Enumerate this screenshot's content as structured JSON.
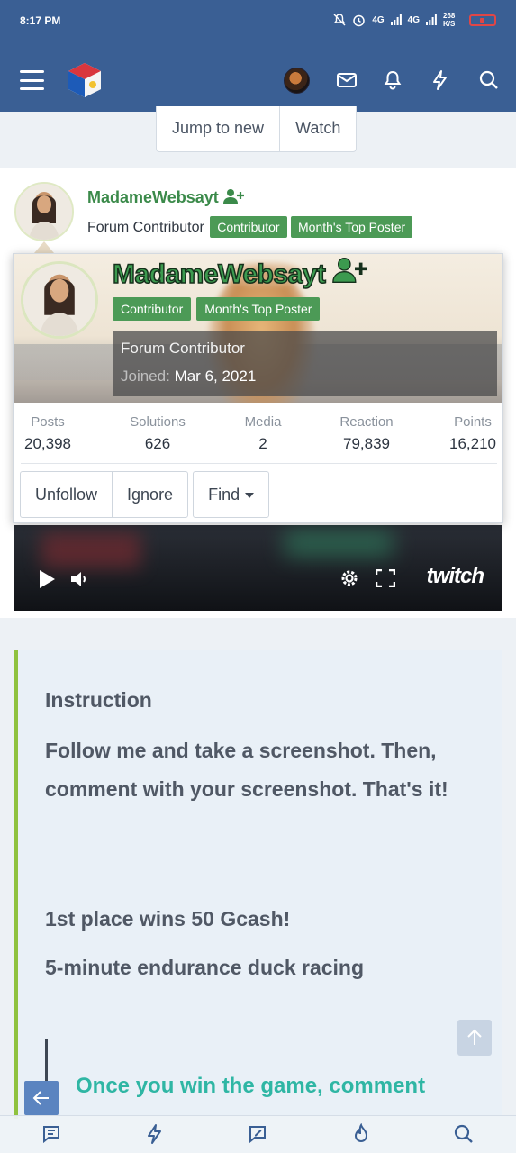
{
  "status_bar": {
    "time": "8:17 PM",
    "net1": "4G",
    "net2": "4G",
    "speed": "268 K/S"
  },
  "header": {
    "menu_icon": "hamburger-icon",
    "logo_icon": "site-logo",
    "icons": [
      "avatar",
      "mail-icon",
      "bell-icon",
      "lightning-icon",
      "search-icon"
    ]
  },
  "thread_actions": {
    "jump_label": "Jump to new",
    "watch_label": "Watch"
  },
  "post": {
    "username": "MadameWebsayt",
    "user_title": "Forum Contributor",
    "badges": [
      "Contributor",
      "Month's Top Poster"
    ]
  },
  "member_card": {
    "username": "MadameWebsayt",
    "badges": [
      "Contributor",
      "Month's Top Poster"
    ],
    "user_title": "Forum Contributor",
    "joined_label": "Joined:",
    "joined_date": "Mar 6, 2021",
    "stats": [
      {
        "label": "Posts",
        "value": "20,398"
      },
      {
        "label": "Solutions",
        "value": "626"
      },
      {
        "label": "Media",
        "value": "2"
      },
      {
        "label": "Reaction",
        "value": "79,839"
      },
      {
        "label": "Points",
        "value": "16,210"
      }
    ],
    "unfollow_label": "Unfollow",
    "ignore_label": "Ignore",
    "find_label": "Find"
  },
  "video": {
    "brand": "twitch"
  },
  "instruction": {
    "heading": "Instruction",
    "body": "Follow me and take a screenshot. Then, comment with your screenshot. That's it!",
    "line1": "1st place wins 50 Gcash!",
    "line2": "5-minute endurance duck racing",
    "cta": "Once you win the game, comment"
  },
  "bottom_nav": {
    "icons": [
      "threads-icon",
      "lightning-icon",
      "compose-icon",
      "fire-icon",
      "search-icon"
    ]
  },
  "colors": {
    "header_bg": "#3a5f94",
    "username_green": "#3b8a4a",
    "badge_green": "#4c9a56",
    "accent_lime": "#8fc23f",
    "cta_teal": "#2fb6a4"
  }
}
